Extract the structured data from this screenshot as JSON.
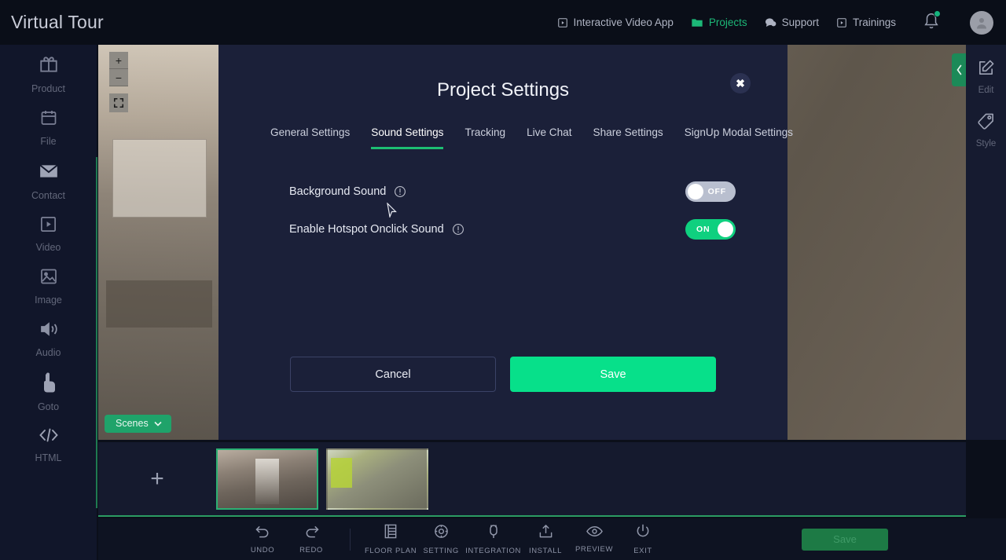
{
  "topbar": {
    "brand": "Virtual Tour",
    "nav": [
      {
        "label": "Interactive Video App",
        "icon": "video-box-icon",
        "active": false
      },
      {
        "label": "Projects",
        "icon": "folder-icon",
        "active": true
      },
      {
        "label": "Support",
        "icon": "chat-icon",
        "active": false
      },
      {
        "label": "Trainings",
        "icon": "video-box-icon",
        "active": false
      }
    ],
    "bell_icon": "notification-bell-icon",
    "avatar_icon": "user-avatar-icon",
    "accent": "#1cb877"
  },
  "left_rail": {
    "items": [
      {
        "label": "Product",
        "icon": "gift-icon"
      },
      {
        "label": "File",
        "icon": "calendar-icon"
      },
      {
        "label": "Contact",
        "icon": "envelope-icon"
      },
      {
        "label": "Video",
        "icon": "video-box-icon"
      },
      {
        "label": "Image",
        "icon": "image-icon"
      },
      {
        "label": "Audio",
        "icon": "speaker-icon"
      },
      {
        "label": "Goto",
        "icon": "pointing-hand-icon"
      },
      {
        "label": "HTML",
        "icon": "code-icon"
      }
    ]
  },
  "right_rail": {
    "items": [
      {
        "label": "Edit",
        "icon": "pencil-square-icon"
      },
      {
        "label": "Style",
        "icon": "tag-pen-icon"
      }
    ],
    "collapse_icon": "chevron-left-icon"
  },
  "viewer": {
    "zoom_in_label": "+",
    "zoom_out_label": "−",
    "fullscreen_icon": "fullscreen-icon",
    "scenes_button_label": "Scenes",
    "scenes_chevron_icon": "chevron-down-icon"
  },
  "modal": {
    "title": "Project Settings",
    "close_icon": "close-icon",
    "tabs": [
      {
        "label": "General Settings",
        "active": false
      },
      {
        "label": "Sound Settings",
        "active": true
      },
      {
        "label": "Tracking",
        "active": false
      },
      {
        "label": "Live Chat",
        "active": false
      },
      {
        "label": "Share Settings",
        "active": false
      },
      {
        "label": "SignUp Modal Settings",
        "active": false
      }
    ],
    "settings": [
      {
        "label": "Background Sound",
        "info_icon": "info-icon",
        "toggle_state": "OFF"
      },
      {
        "label": "Enable Hotspot Onclick Sound",
        "info_icon": "info-icon",
        "toggle_state": "ON"
      }
    ],
    "cancel_label": "Cancel",
    "save_label": "Save",
    "accent_green": "#1dbf73",
    "save_green": "#07e08a",
    "background": "#1b2039"
  },
  "scenes": {
    "add_label": "+",
    "thumbnails": [
      {
        "name": "scene-1",
        "selected": true
      },
      {
        "name": "scene-2",
        "selected": false
      }
    ]
  },
  "bottombar": {
    "tools": [
      {
        "label": "UNDO",
        "icon": "undo-icon"
      },
      {
        "label": "REDO",
        "icon": "redo-icon"
      },
      {
        "label": "FLOOR PLAN",
        "icon": "floorplan-icon"
      },
      {
        "label": "SETTING",
        "icon": "gear-icon"
      },
      {
        "label": "INTEGRATION",
        "icon": "plug-icon"
      },
      {
        "label": "INSTALL",
        "icon": "install-icon"
      },
      {
        "label": "PREVIEW",
        "icon": "eye-icon"
      },
      {
        "label": "EXIT",
        "icon": "power-icon"
      }
    ],
    "save_label": "Save"
  }
}
